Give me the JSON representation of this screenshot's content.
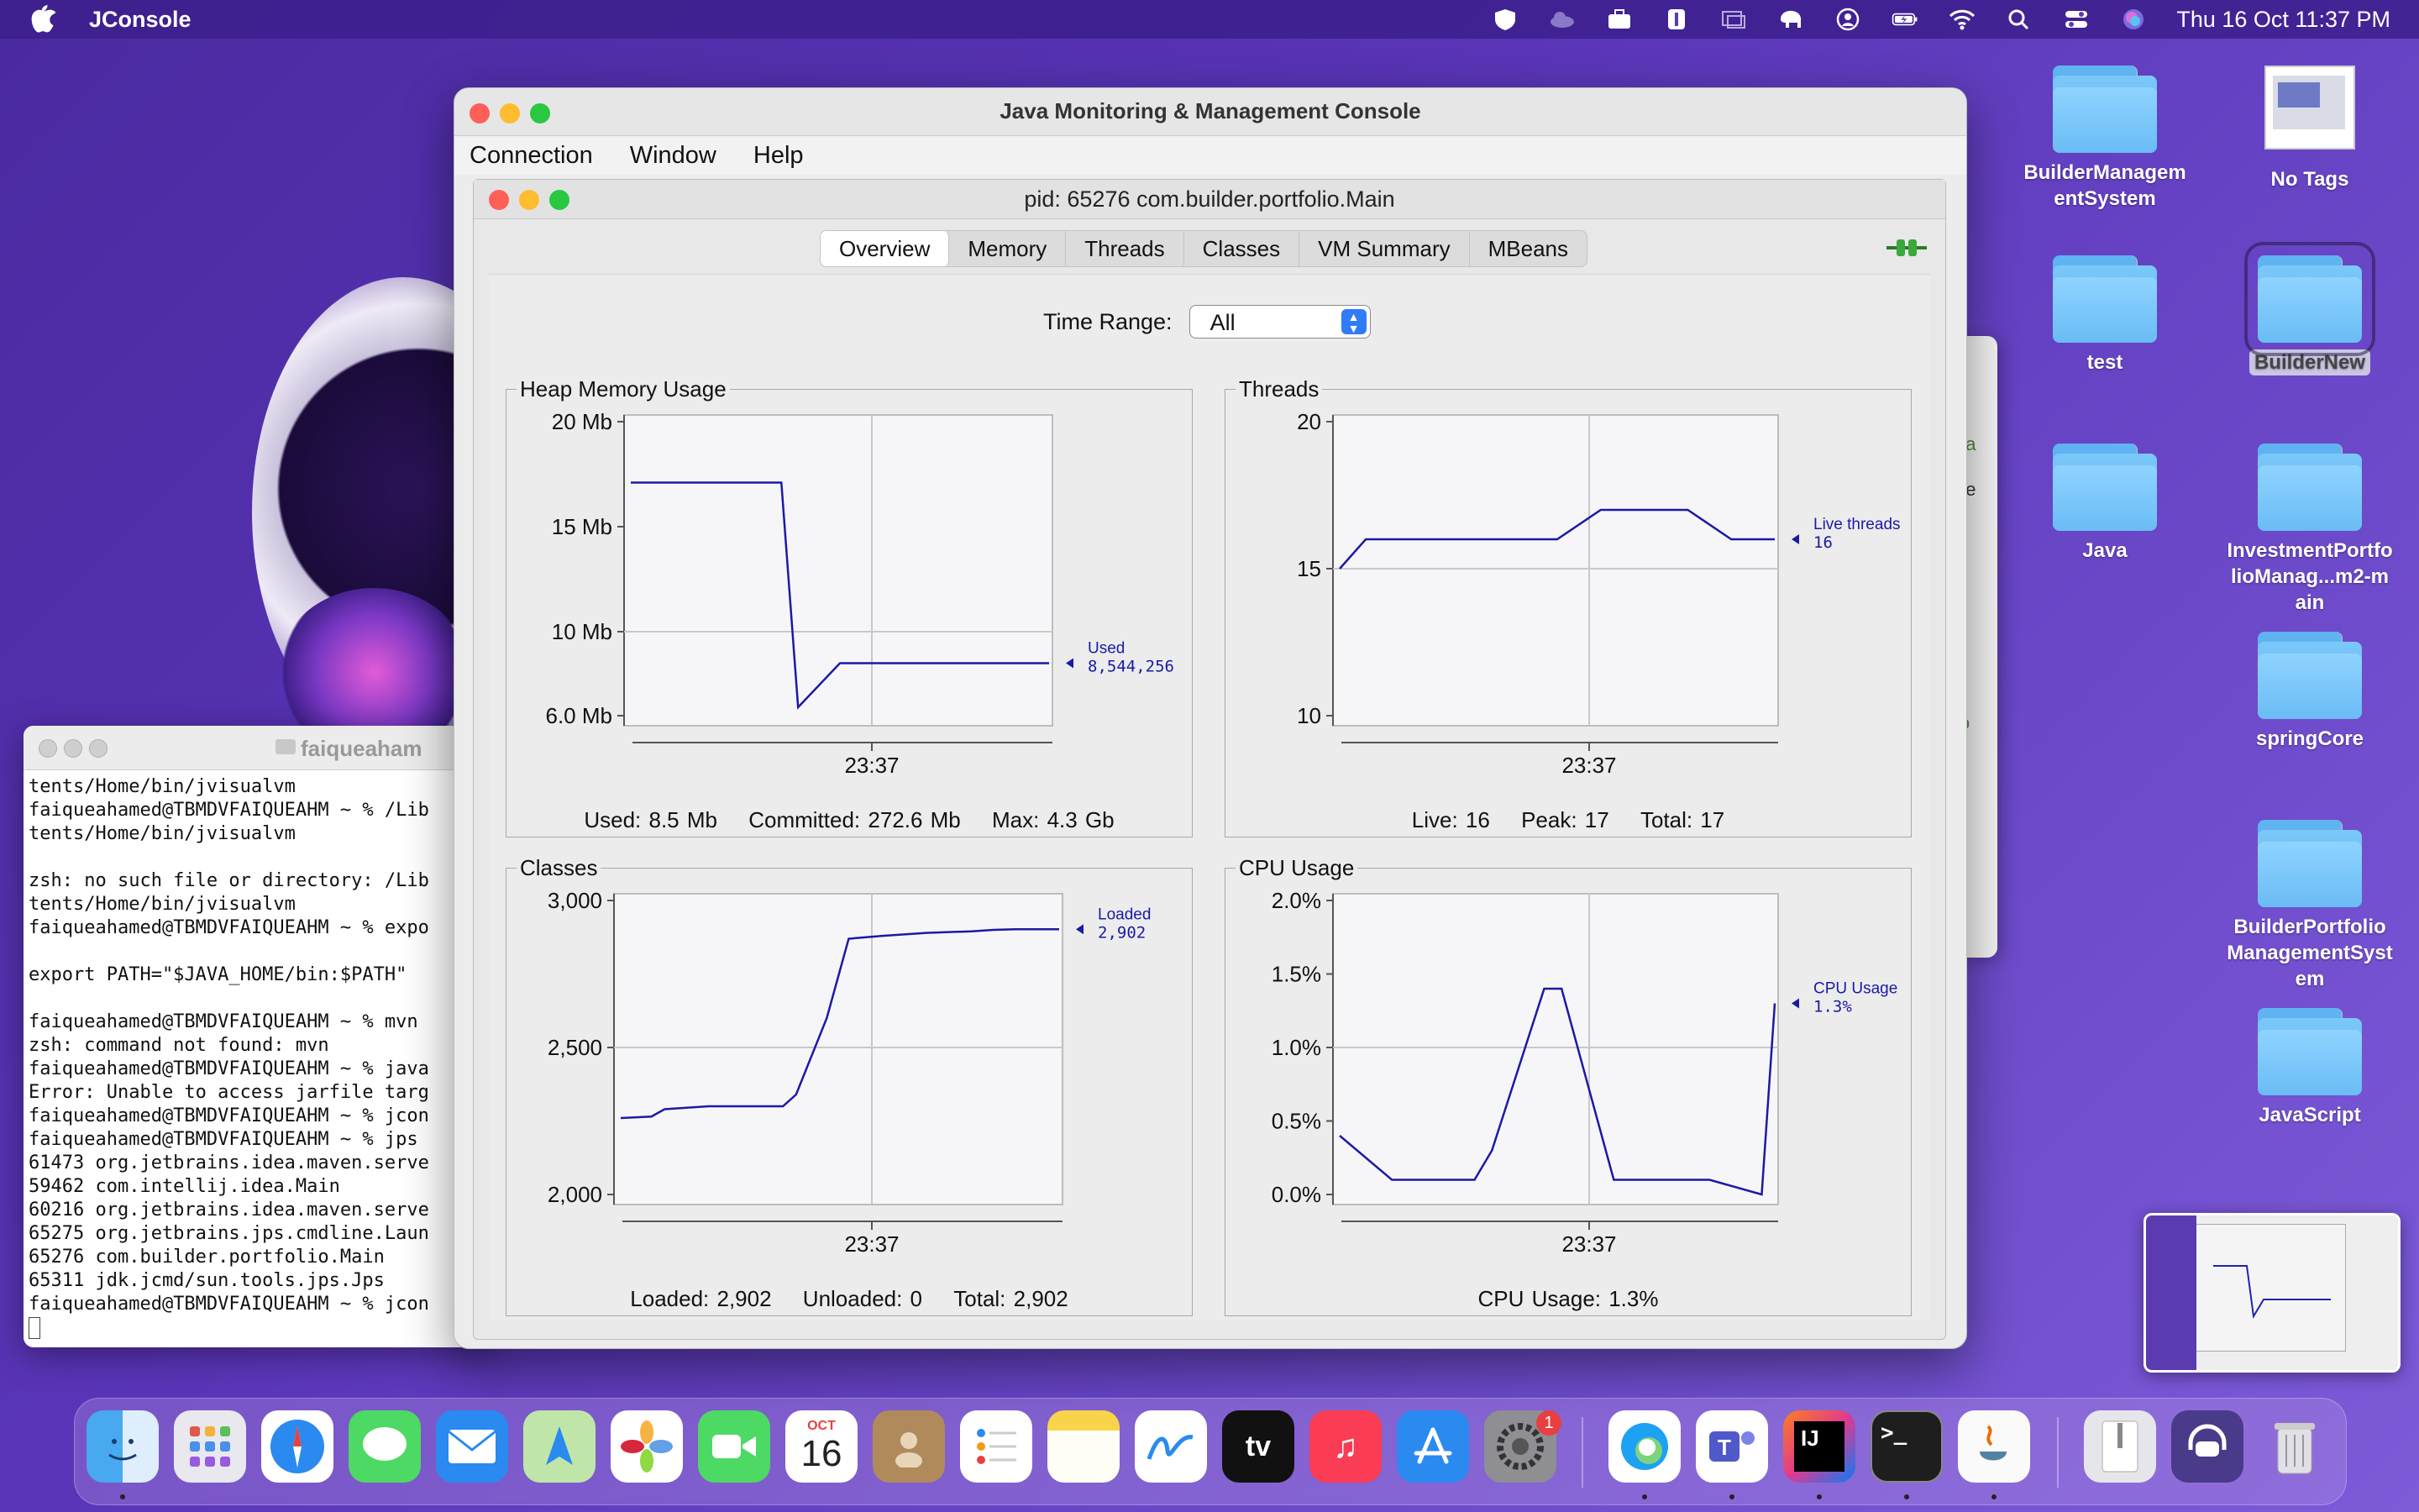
{
  "menubar": {
    "app_name": "JConsole",
    "clock": "Thu 16 Oct  11:37 PM"
  },
  "desktop_icons": [
    {
      "label": "BuilderManagementSystem"
    },
    {
      "label": "No Tags"
    },
    {
      "label": "test"
    },
    {
      "label": "BuilderNew"
    },
    {
      "label": "Java"
    },
    {
      "label": "InvestmentPortfolioManag...m2-main"
    },
    {
      "label": "springCore"
    },
    {
      "label": "BuilderPortfolioManagementSystem"
    },
    {
      "label": "JavaScript"
    }
  ],
  "window": {
    "title": "Java Monitoring & Management Console",
    "menu": [
      "Connection",
      "Window",
      "Help"
    ],
    "inner_title": "pid: 65276 com.builder.portfolio.Main",
    "tabs": [
      "Overview",
      "Memory",
      "Threads",
      "Classes",
      "VM Summary",
      "MBeans"
    ],
    "active_tab": "Overview",
    "time_range_label": "Time Range:",
    "time_range_value": "All"
  },
  "panels": {
    "heap": {
      "title": "Heap Memory Usage",
      "footer": [
        "Used: 8.5 Mb",
        "Committed: 272.6 Mb",
        "Max: 4.3 Gb"
      ]
    },
    "threads": {
      "title": "Threads",
      "footer": [
        "Live: 16",
        "Peak: 17",
        "Total: 17"
      ]
    },
    "classes": {
      "title": "Classes",
      "footer": [
        "Loaded: 2,902",
        "Unloaded: 0",
        "Total: 2,902"
      ]
    },
    "cpu": {
      "title": "CPU Usage",
      "footer": [
        "CPU Usage: 1.3%"
      ]
    }
  },
  "chart_data": [
    {
      "type": "line",
      "id": "heap",
      "yticks": [
        "20 Mb",
        "15 Mb",
        "10 Mb",
        "6.0 Mb"
      ],
      "ytick_values": [
        20,
        15,
        10,
        6
      ],
      "ylim": [
        6,
        20
      ],
      "xtick": "23:37",
      "series": [
        {
          "name": "Used",
          "legend_value": "8,544,256",
          "values": [
            17.1,
            17.1,
            17.1,
            17.1,
            17.1,
            17.1,
            6.4,
            8.5,
            8.5,
            8.5,
            8.5,
            8.5,
            8.5
          ]
        }
      ],
      "x": [
        0,
        0.1,
        0.2,
        0.3,
        0.35,
        0.36,
        0.4,
        0.5,
        0.6,
        0.7,
        0.8,
        0.9,
        1.0
      ]
    },
    {
      "type": "line",
      "id": "threads",
      "yticks": [
        "20",
        "15",
        "10"
      ],
      "ytick_values": [
        20,
        15,
        10
      ],
      "ylim": [
        10,
        20
      ],
      "xtick": "23:37",
      "series": [
        {
          "name": "Live threads",
          "legend_value": "16",
          "values": [
            15,
            16,
            16,
            16,
            16,
            16,
            17,
            17,
            17,
            16,
            16,
            16
          ]
        }
      ],
      "x": [
        0,
        0.06,
        0.2,
        0.3,
        0.4,
        0.5,
        0.6,
        0.7,
        0.8,
        0.9,
        0.95,
        1.0
      ]
    },
    {
      "type": "line",
      "id": "classes",
      "yticks": [
        "3,000",
        "2,500",
        "2,000"
      ],
      "ytick_values": [
        3000,
        2500,
        2000
      ],
      "ylim": [
        2000,
        3000
      ],
      "xtick": "23:37",
      "series": [
        {
          "name": "Loaded",
          "legend_value": "2,902",
          "values": [
            2260,
            2265,
            2290,
            2300,
            2300,
            2300,
            2340,
            2600,
            2870,
            2880,
            2890,
            2895,
            2900,
            2902,
            2902
          ]
        }
      ],
      "x": [
        0,
        0.07,
        0.1,
        0.2,
        0.3,
        0.37,
        0.4,
        0.47,
        0.52,
        0.6,
        0.7,
        0.8,
        0.85,
        0.9,
        1.0
      ]
    },
    {
      "type": "line",
      "id": "cpu",
      "yticks": [
        "2.0%",
        "1.5%",
        "1.0%",
        "0.5%",
        "0.0%"
      ],
      "ytick_values": [
        2.0,
        1.5,
        1.0,
        0.5,
        0.0
      ],
      "ylim": [
        0,
        2
      ],
      "xtick": "23:37",
      "series": [
        {
          "name": "CPU Usage",
          "legend_value": "1.3%",
          "values": [
            0.4,
            0.1,
            0.1,
            0.1,
            0.3,
            1.4,
            1.4,
            0.1,
            0.1,
            0.1,
            0.0,
            1.3
          ]
        }
      ],
      "x": [
        0,
        0.12,
        0.25,
        0.31,
        0.35,
        0.47,
        0.51,
        0.63,
        0.78,
        0.85,
        0.97,
        1.0
      ]
    }
  ],
  "terminal": {
    "title": "faiqueaham",
    "lines": [
      "tents/Home/bin/jvisualvm",
      "faiqueahamed@TBMDVFAIQUEAHM ~ % /Lib",
      "tents/Home/bin/jvisualvm",
      "",
      "zsh: no such file or directory: /Lib",
      "tents/Home/bin/jvisualvm",
      "faiqueahamed@TBMDVFAIQUEAHM ~ % expo",
      "",
      "export PATH=\"$JAVA_HOME/bin:$PATH\"",
      "",
      "faiqueahamed@TBMDVFAIQUEAHM ~ % mvn",
      "zsh: command not found: mvn",
      "faiqueahamed@TBMDVFAIQUEAHM ~ % java",
      "Error: Unable to access jarfile targ",
      "faiqueahamed@TBMDVFAIQUEAHM ~ % jcon",
      "faiqueahamed@TBMDVFAIQUEAHM ~ % jps",
      "61473 org.jetbrains.idea.maven.serve",
      "59462 com.intellij.idea.Main",
      "60216 org.jetbrains.idea.maven.serve",
      "65275 org.jetbrains.jps.cmdline.Laun",
      "65276 com.builder.portfolio.Main",
      "65311 jdk.jcmd/sun.tools.jps.Jps",
      "faiqueahamed@TBMDVFAIQUEAHM ~ % jcon"
    ]
  },
  "ghost_window": [
    "ea",
    "ge",
    "lo"
  ],
  "dock": {
    "calendar_month": "OCT",
    "calendar_day": "16",
    "settings_badge": "1",
    "apps": [
      "finder-icon",
      "launchpad-icon",
      "safari-icon",
      "messages-icon",
      "mail-icon",
      "maps-icon",
      "photos-icon",
      "facetime-icon",
      "calendar-icon",
      "contacts-icon",
      "reminders-icon",
      "notes-icon",
      "freeform-icon",
      "tv-icon",
      "music-icon",
      "app-store-icon",
      "system-settings-icon",
      "edge-icon",
      "teams-icon",
      "intellij-icon",
      "terminal-icon",
      "java-icon",
      "zip-icon",
      "support-icon",
      "trash-icon"
    ]
  }
}
